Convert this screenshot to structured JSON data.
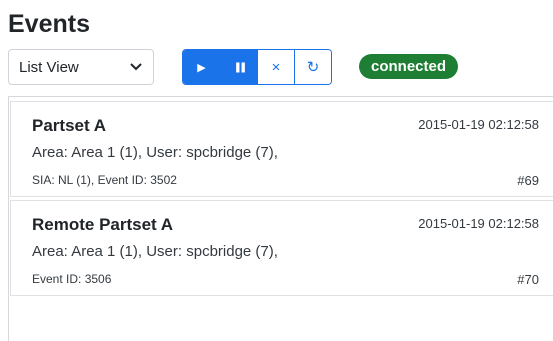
{
  "header": {
    "title": "Events"
  },
  "controls": {
    "view_select": {
      "value": "List View",
      "icon": "chevron-down-icon"
    },
    "buttons": [
      {
        "name": "play",
        "icon": "play-icon",
        "glyph": "▶"
      },
      {
        "name": "pause",
        "icon": "pause-icon",
        "glyph": "❚❚"
      },
      {
        "name": "clear",
        "icon": "close-icon",
        "glyph": "×"
      },
      {
        "name": "refresh",
        "icon": "refresh-icon",
        "glyph": "↻"
      }
    ],
    "status": "connected"
  },
  "colors": {
    "primary": "#1a73e8",
    "success": "#1e7e34"
  },
  "events": [
    {
      "title": "Partset A",
      "timestamp": "2015-01-19 02:12:58",
      "detail": "Area: Area 1 (1), User: spcbridge (7),",
      "meta": "SIA: NL (1), Event ID: 3502",
      "number": "#69"
    },
    {
      "title": "Remote Partset A",
      "timestamp": "2015-01-19 02:12:58",
      "detail": "Area: Area 1 (1), User: spcbridge (7),",
      "meta": "Event ID: 3506",
      "number": "#70"
    }
  ]
}
